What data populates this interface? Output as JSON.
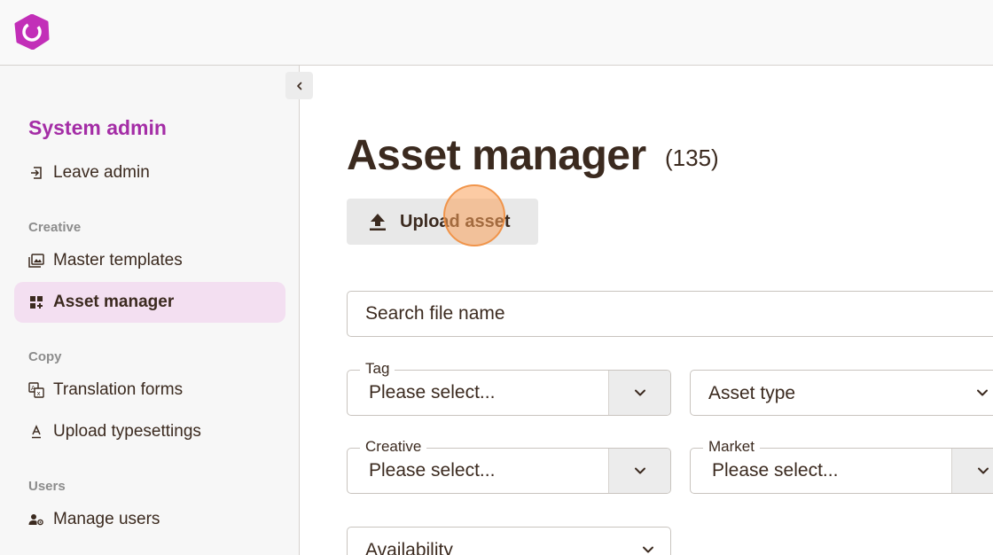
{
  "sidebar": {
    "title": "System admin",
    "leave_admin": "Leave admin",
    "sections": {
      "creative": "Creative",
      "copy": "Copy",
      "users": "Users"
    },
    "items": [
      {
        "label": "Master templates",
        "icon": "image-gallery-icon"
      },
      {
        "label": "Asset manager",
        "icon": "dashboard-add-icon",
        "active": true
      },
      {
        "label": "Translation forms",
        "icon": "translate-icon"
      },
      {
        "label": "Upload typesettings",
        "icon": "text-format-icon"
      },
      {
        "label": "Manage users",
        "icon": "manage-accounts-icon"
      }
    ]
  },
  "main": {
    "title": "Asset manager",
    "count": "(135)",
    "upload_label": "Upload asset",
    "search_placeholder": "Search file name",
    "filters": {
      "tag": {
        "label": "Tag",
        "value": "Please select..."
      },
      "asset_type": {
        "value": "Asset type"
      },
      "creative": {
        "label": "Creative",
        "value": "Please select..."
      },
      "market": {
        "label": "Market",
        "value": "Please select..."
      },
      "availability": {
        "value": "Availability"
      }
    }
  },
  "colors": {
    "brand": "#a42da6",
    "active_bg": "#f3dff1",
    "text": "#3b2a1f"
  }
}
